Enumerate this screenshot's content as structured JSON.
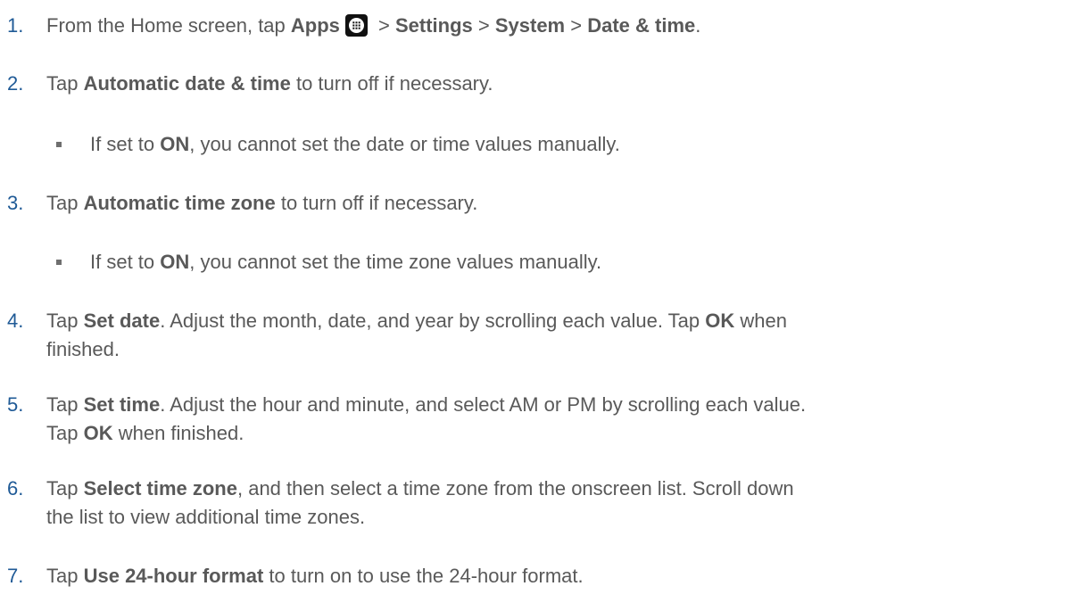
{
  "steps": [
    {
      "num": "1.",
      "parts": {
        "t1": "From the Home screen, tap ",
        "b1": "Apps",
        "t2": " > ",
        "b2": "Settings",
        "t3": " > ",
        "b3": "System",
        "t4": " > ",
        "b4": "Date & time",
        "t5": "."
      },
      "icon": "apps-grid-icon"
    },
    {
      "num": "2.",
      "parts": {
        "t1": "Tap ",
        "b1": "Automatic date & time",
        "t2": " to turn off if necessary."
      }
    },
    {
      "num": "3.",
      "parts": {
        "t1": "Tap ",
        "b1": "Automatic time zone",
        "t2": " to turn off if necessary."
      }
    },
    {
      "num": "4.",
      "line1": {
        "t1": "Tap ",
        "b1": "Set date",
        "t2": ". Adjust the month, date, and year by scrolling each value. Tap ",
        "b2": "OK",
        "t3": " when"
      },
      "line2": "finished."
    },
    {
      "num": "5.",
      "line1": {
        "t1": "Tap ",
        "b1": "Set time",
        "t2": ". Adjust the hour and minute, and select AM or PM by scrolling each value."
      },
      "line2": {
        "t1": "Tap ",
        "b1": "OK",
        "t2": " when finished."
      }
    },
    {
      "num": "6.",
      "line1": {
        "t1": "Tap ",
        "b1": "Select time zone",
        "t2": ", and then select a time zone from the onscreen list. Scroll down"
      },
      "line2": "the list to view additional time zones."
    },
    {
      "num": "7.",
      "parts": {
        "t1": "Tap ",
        "b1": "Use 24-hour format",
        "t2": " to turn on to use the 24-hour format."
      }
    }
  ],
  "bullets": [
    {
      "t1": "If set to ",
      "b1": "ON",
      "t2": ", you cannot set the date or time values manually."
    },
    {
      "t1": "If set to ",
      "b1": "ON",
      "t2": ", you cannot set the time zone values manually."
    }
  ],
  "colors": {
    "number": "#1f5a96",
    "text": "#595959",
    "bullet": "#6f6f6f"
  }
}
